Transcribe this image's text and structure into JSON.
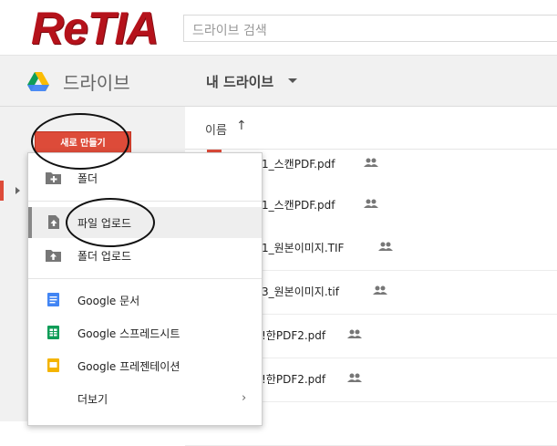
{
  "logo": {
    "text": "ReTIA"
  },
  "search": {
    "placeholder": "드라이브 검색"
  },
  "appbar": {
    "title": "드라이브",
    "location": "내 드라이브"
  },
  "sidebar": {
    "new_button": "새로 만들기"
  },
  "list": {
    "header_name": "이름",
    "rows": [
      {
        "name": "1_스캔PDF.pdf",
        "shared": true
      },
      {
        "name": "1_스캔PDF.pdf",
        "shared": true
      },
      {
        "name": "1_원본이미지.TIF",
        "shared": true
      },
      {
        "name": "3_원본이미지.tif",
        "shared": true
      },
      {
        "name": "!한PDF2.pdf",
        "shared": true
      },
      {
        "name": "!한PDF2.pdf",
        "shared": true
      }
    ]
  },
  "menu": {
    "items": [
      {
        "label": "폴더",
        "icon": "folder-plus-icon"
      },
      {
        "label": "파일 업로드",
        "icon": "file-upload-icon"
      },
      {
        "label": "폴더 업로드",
        "icon": "folder-upload-icon"
      },
      {
        "label": "Google 문서",
        "icon": "google-docs-icon"
      },
      {
        "label": "Google 스프레드시트",
        "icon": "google-sheets-icon"
      },
      {
        "label": "Google 프레젠테이션",
        "icon": "google-slides-icon"
      },
      {
        "label": "더보기",
        "icon": "chevron-right-icon"
      }
    ]
  },
  "colors": {
    "accent": "#dd4b39",
    "docs": "#4285f4",
    "sheets": "#0f9d58",
    "slides": "#f4b400",
    "logo": "#b5121b"
  }
}
